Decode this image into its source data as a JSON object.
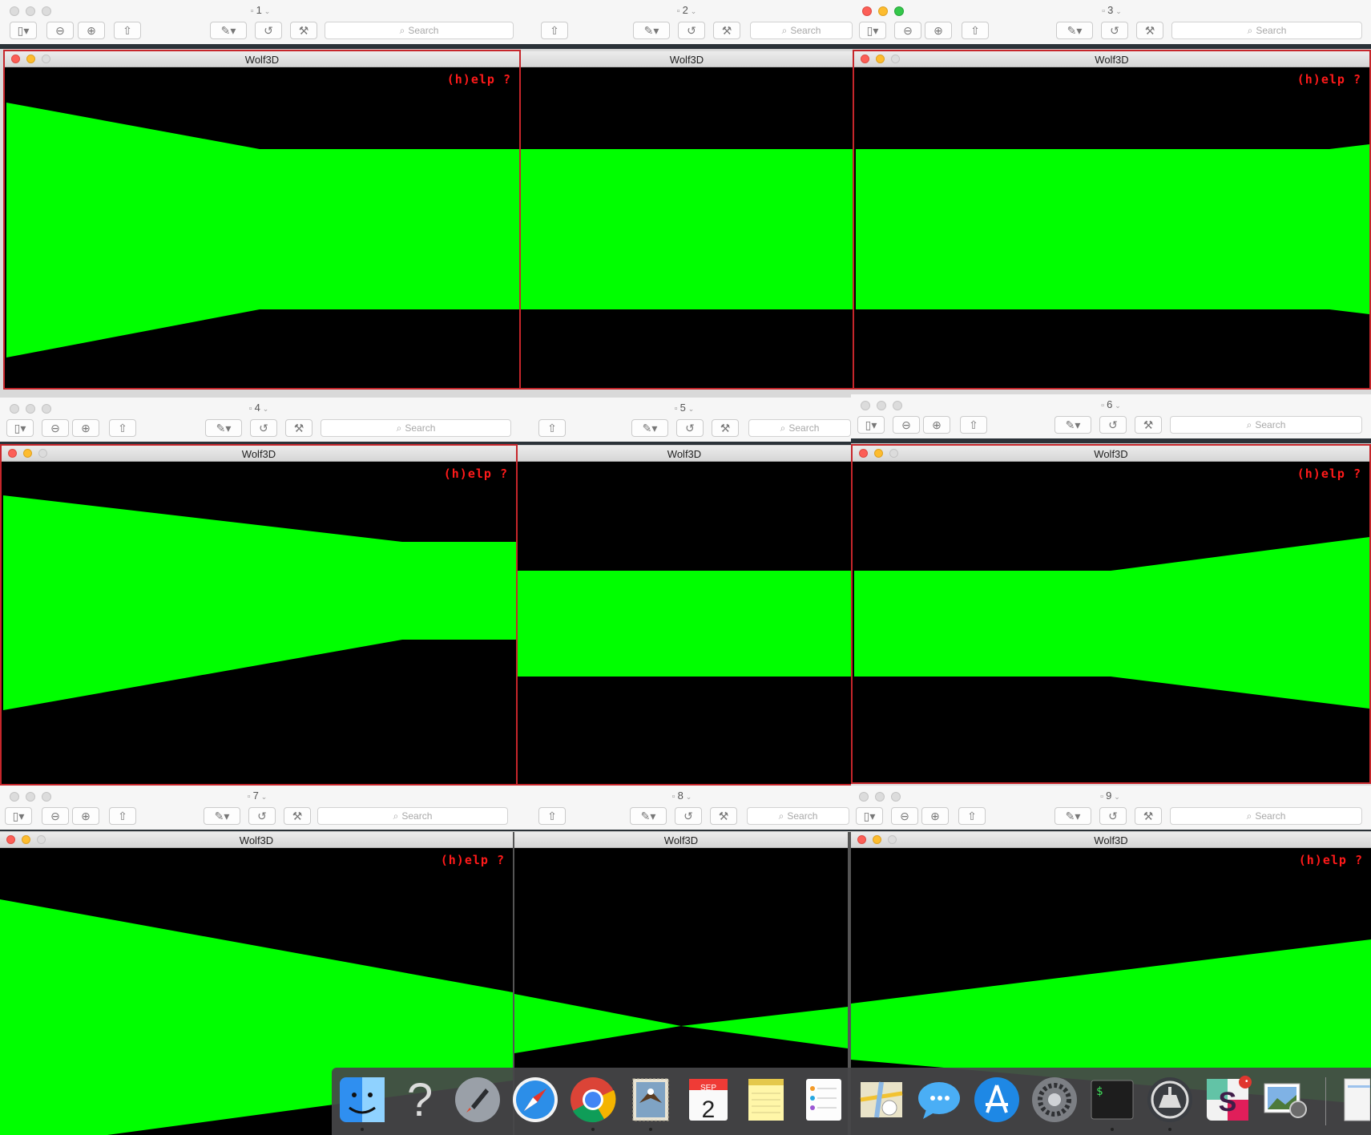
{
  "preview": {
    "search_placeholder": "Search",
    "documents": [
      {
        "number": "1"
      },
      {
        "number": "2"
      },
      {
        "number": "3"
      },
      {
        "number": "4"
      },
      {
        "number": "5"
      },
      {
        "number": "6"
      },
      {
        "number": "7"
      },
      {
        "number": "8"
      },
      {
        "number": "9"
      }
    ]
  },
  "wolf": {
    "window_title": "Wolf3D",
    "help_text": "(h)elp ?",
    "floor_color": "#000000",
    "wall_color": "#00ff00",
    "frame_color": "#c6262b"
  },
  "dock": {
    "calendar_month": "SEP",
    "calendar_day": "2",
    "terminal_prompt": "$",
    "slack_badge": "•",
    "apps": [
      {
        "name": "Finder",
        "icon": "finder-icon"
      },
      {
        "name": "Help",
        "icon": "question-mark-icon"
      },
      {
        "name": "Launchpad",
        "icon": "rocket-icon"
      },
      {
        "name": "Safari",
        "icon": "compass-icon"
      },
      {
        "name": "Chrome",
        "icon": "chrome-icon"
      },
      {
        "name": "Mail",
        "icon": "eagle-stamp-icon"
      },
      {
        "name": "Calendar",
        "icon": "calendar-icon"
      },
      {
        "name": "Notes",
        "icon": "notepad-icon"
      },
      {
        "name": "Reminders",
        "icon": "checklist-icon"
      },
      {
        "name": "Maps",
        "icon": "map-icon"
      },
      {
        "name": "Messages",
        "icon": "speech-bubble-icon"
      },
      {
        "name": "App Store",
        "icon": "app-store-icon"
      },
      {
        "name": "System Preferences",
        "icon": "gear-icon"
      },
      {
        "name": "Terminal",
        "icon": "terminal-icon"
      },
      {
        "name": "Xcode",
        "icon": "hammer-icon"
      },
      {
        "name": "Slack",
        "icon": "slack-icon"
      },
      {
        "name": "Preview",
        "icon": "photos-icon"
      },
      {
        "name": "Downloads",
        "icon": "document-stack-icon"
      }
    ]
  }
}
